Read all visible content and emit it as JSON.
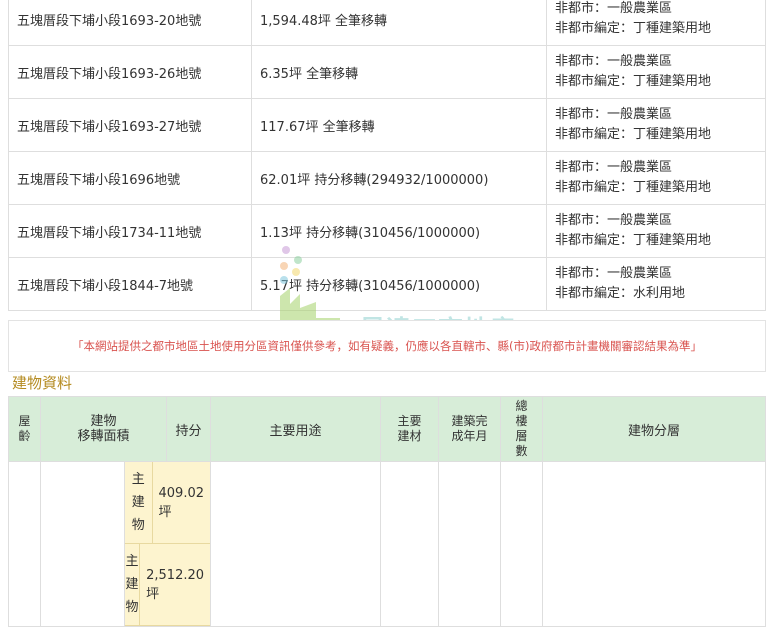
{
  "land_rows": [
    {
      "parcel": "五塊厝段下埔小段1693-20地號",
      "area": "1,594.48坪 全筆移轉",
      "zone_1": "非都市：一般農業區",
      "zone_2": "非都市編定：丁種建築用地"
    },
    {
      "parcel": "五塊厝段下埔小段1693-26地號",
      "area": "6.35坪 全筆移轉",
      "zone_1": "非都市：一般農業區",
      "zone_2": "非都市編定：丁種建築用地"
    },
    {
      "parcel": "五塊厝段下埔小段1693-27地號",
      "area": "117.67坪 全筆移轉",
      "zone_1": "非都市：一般農業區",
      "zone_2": "非都市編定：丁種建築用地"
    },
    {
      "parcel": "五塊厝段下埔小段1696地號",
      "area": "62.01坪 持分移轉(294932/1000000)",
      "zone_1": "非都市：一般農業區",
      "zone_2": "非都市編定：丁種建築用地"
    },
    {
      "parcel": "五塊厝段下埔小段1734-11地號",
      "area": "1.13坪 持分移轉(310456/1000000)",
      "zone_1": "非都市：一般農業區",
      "zone_2": "非都市編定：丁種建築用地"
    },
    {
      "parcel": "五塊厝段下埔小段1844-7地號",
      "area": "5.17坪 持分移轉(310456/1000000)",
      "zone_1": "非都市：一般農業區",
      "zone_2": "非都市編定：水利用地"
    }
  ],
  "notice": "「本網站提供之都市地區土地使用分區資訊僅供參考，如有疑義，仍應以各直轄市、縣(市)政府都市計畫機關審認結果為準」",
  "watermark": "昱達工商地產",
  "building_section_title": "建物資料",
  "building_headers": {
    "age": "屋齡",
    "area": "建物\n移轉面積",
    "share": "持分",
    "use": "主要用途",
    "material": "主要建材",
    "completion": "建築完成年月",
    "floors": "總樓層數",
    "layer": "建物分層"
  },
  "building_sub_rows": [
    {
      "label": "主建物",
      "value": "409.02坪"
    },
    {
      "label": "主建物",
      "value": "2,512.20坪"
    }
  ],
  "colors": {
    "header_green": "#d7edd8",
    "notice_red": "#d9534f",
    "title_gold": "#b58c23",
    "sub_yellow": "#fdf4cf"
  }
}
